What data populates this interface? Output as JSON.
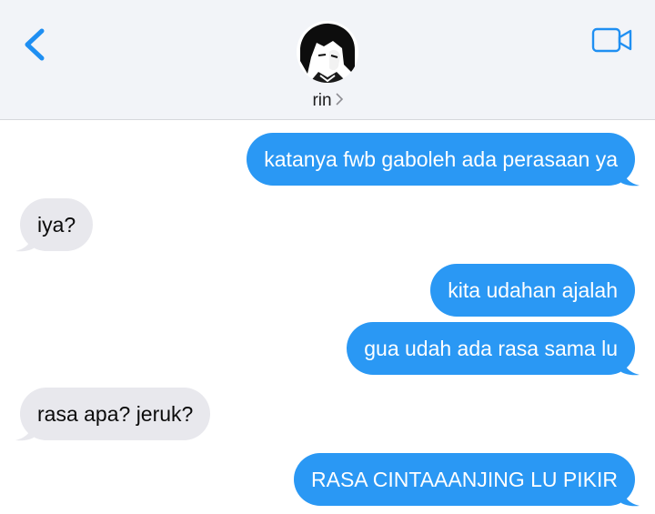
{
  "header": {
    "contact_name": "rin",
    "back_icon": "chevron-left-icon",
    "video_icon": "video-camera-icon",
    "accent_color": "#2a98f4"
  },
  "messages": [
    {
      "direction": "outgoing",
      "text": "katanya fwb gaboleh ada perasaan ya"
    },
    {
      "direction": "incoming",
      "text": "iya?"
    },
    {
      "direction": "outgoing",
      "text": "kita udahan ajalah"
    },
    {
      "direction": "outgoing",
      "text": "gua udah ada rasa sama lu"
    },
    {
      "direction": "incoming",
      "text": "rasa apa? jeruk?"
    },
    {
      "direction": "outgoing",
      "text": "RASA CINTAAANJING LU PIKIR"
    }
  ],
  "colors": {
    "outgoing_bubble": "#2a98f4",
    "incoming_bubble": "#e8e8ed",
    "header_bg": "#f2f4f8"
  }
}
